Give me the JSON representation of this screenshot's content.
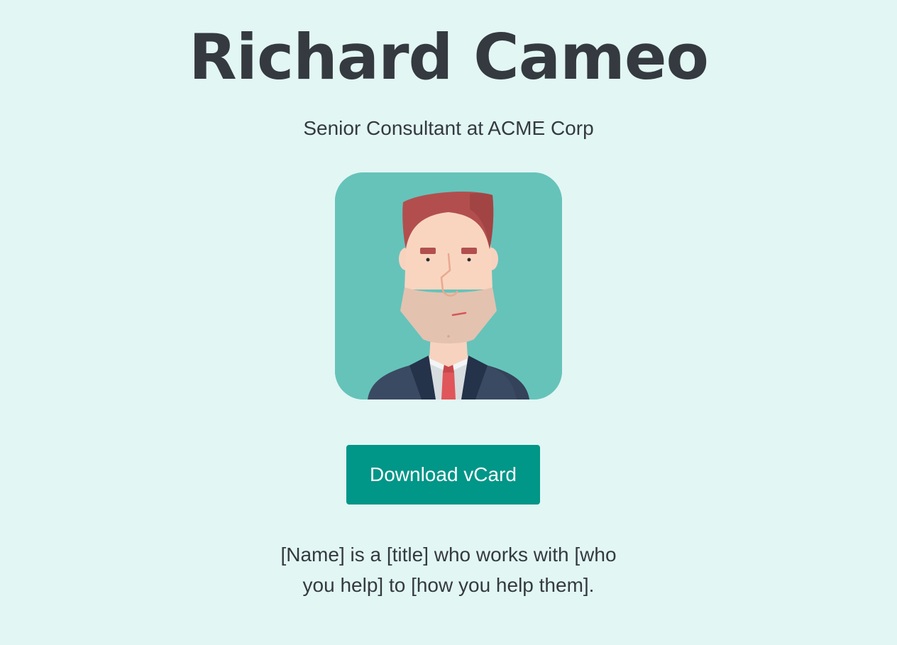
{
  "profile": {
    "name": "Richard Cameo",
    "title": "Senior Consultant at ACME Corp",
    "avatar_icon": "businessman-avatar-icon",
    "bio": "[Name] is a [title] who works with [who you help] to [how you help them]."
  },
  "actions": {
    "download_label": "Download vCard"
  },
  "colors": {
    "background": "#e2f6f4",
    "text": "#343a40",
    "button": "#009688",
    "avatar_bg": "#66c3ba"
  }
}
